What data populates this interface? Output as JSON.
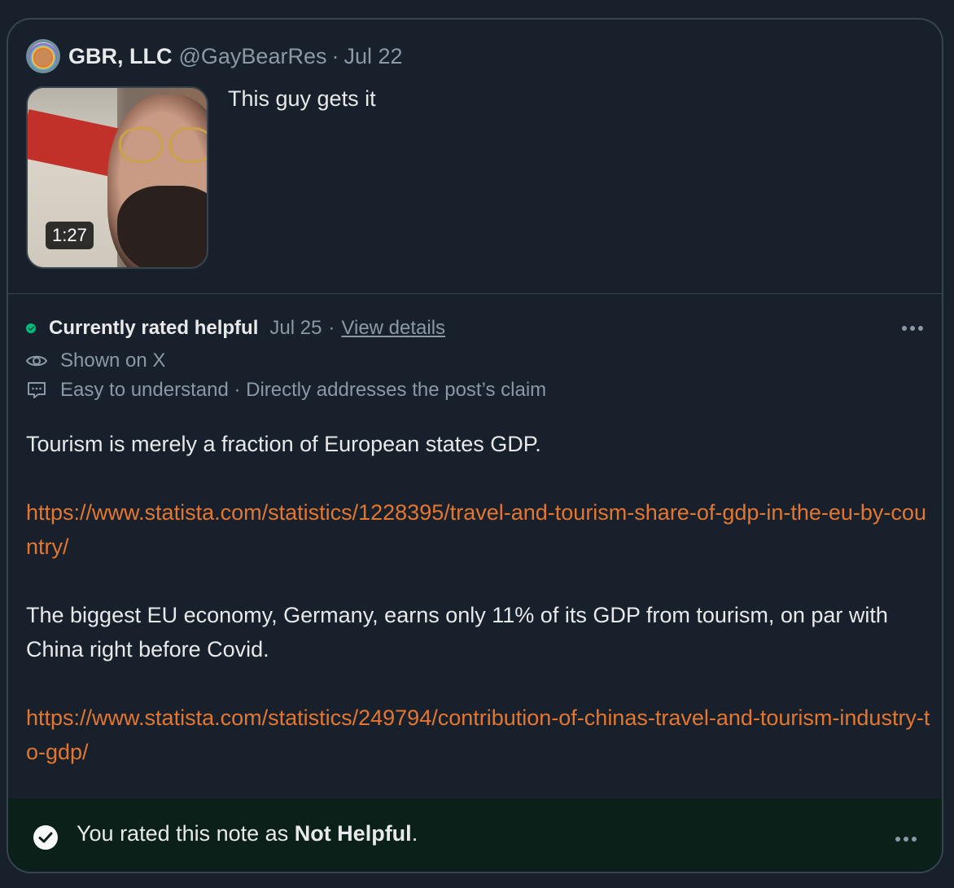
{
  "post": {
    "author_name": "GBR, LLC",
    "author_handle": "@GayBearRes",
    "separator": "·",
    "date": "Jul 22",
    "text": "This guy gets it",
    "video_duration": "1:27"
  },
  "note": {
    "status_label": "Currently rated helpful",
    "date": "Jul 25",
    "separator": "·",
    "view_details": "View details",
    "shown_on": "Shown on X",
    "tags": "Easy to understand · Directly addresses the post’s claim",
    "paragraph1": "Tourism is merely a fraction of European states GDP.",
    "link1": "https://www.statista.com/statistics/1228395/travel-and-tourism-share-of-gdp-in-the-eu-by-country/",
    "paragraph2": "The biggest EU economy, Germany, earns only 11% of its GDP from tourism, on par with China right before Covid.",
    "link2": "https://www.statista.com/statistics/249794/contribution-of-chinas-travel-and-tourism-industry-to-gdp/"
  },
  "rating": {
    "prefix": "You rated this note as ",
    "value": "Not Helpful",
    "suffix": "."
  },
  "colors": {
    "background": "#17202b",
    "border": "#38444d",
    "text_primary": "#e7e9ea",
    "text_secondary": "#8b98a5",
    "link": "#e5762f",
    "status_green": "#00ba7c",
    "rating_bar_bg": "#0b2018"
  },
  "icons": {
    "more": "more-horizontal-icon",
    "eye": "eye-icon",
    "comment": "comment-icon",
    "check": "check-circle-icon"
  }
}
